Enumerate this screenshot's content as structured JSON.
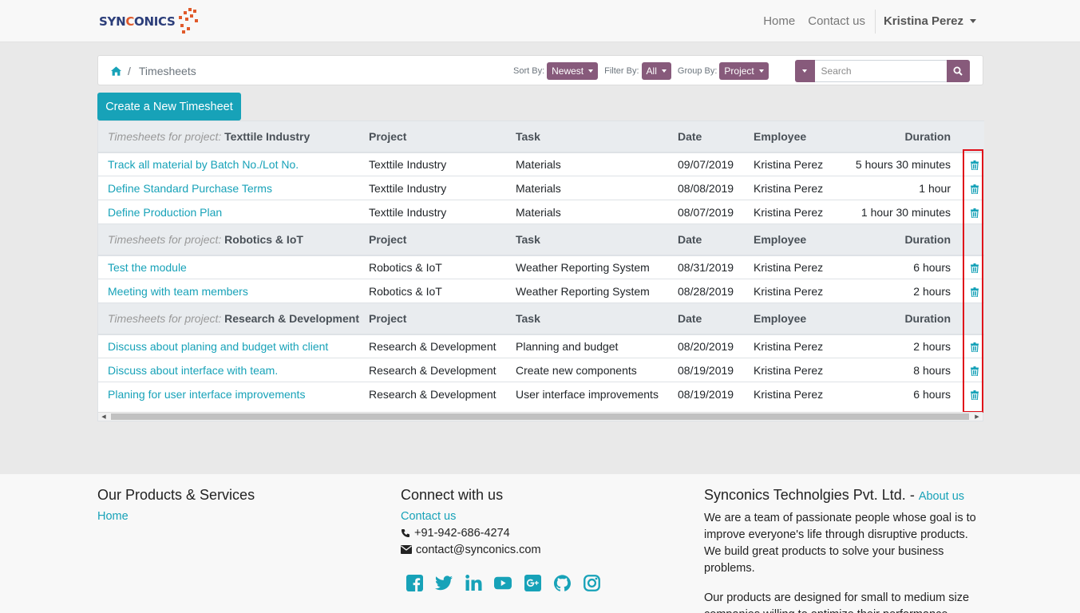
{
  "brand": {
    "name_part1": "SYN",
    "name_part2": "C",
    "name_part3": "ONICS",
    "accent": "#e05a2b",
    "primary": "#2c3e7a"
  },
  "nav": {
    "home": "Home",
    "contact": "Contact us",
    "user": "Kristina Perez"
  },
  "breadcrumb": {
    "current": "Timesheets"
  },
  "filters": {
    "sort_label": "Sort By:",
    "sort_value": "Newest",
    "filter_label": "Filter By:",
    "filter_value": "All",
    "group_label": "Group By:",
    "group_value": "Project"
  },
  "search": {
    "placeholder": "Search"
  },
  "create_button": "Create a New Timesheet",
  "table": {
    "group_prefix": "Timesheets for project:",
    "headers": {
      "project": "Project",
      "task": "Task",
      "date": "Date",
      "employee": "Employee",
      "duration": "Duration"
    },
    "groups": [
      {
        "name": "Texttile Industry",
        "rows": [
          {
            "title": "Track all material by Batch No./Lot No.",
            "project": "Texttile Industry",
            "task": "Materials",
            "date": "09/07/2019",
            "employee": "Kristina Perez",
            "duration": "5 hours 30 minutes"
          },
          {
            "title": "Define Standard Purchase Terms",
            "project": "Texttile Industry",
            "task": "Materials",
            "date": "08/08/2019",
            "employee": "Kristina Perez",
            "duration": "1 hour"
          },
          {
            "title": "Define Production Plan",
            "project": "Texttile Industry",
            "task": "Materials",
            "date": "08/07/2019",
            "employee": "Kristina Perez",
            "duration": "1 hour 30 minutes"
          }
        ]
      },
      {
        "name": "Robotics & IoT",
        "rows": [
          {
            "title": "Test the module",
            "project": "Robotics & IoT",
            "task": "Weather Reporting System",
            "date": "08/31/2019",
            "employee": "Kristina Perez",
            "duration": "6 hours"
          },
          {
            "title": "Meeting with team members",
            "project": "Robotics & IoT",
            "task": "Weather Reporting System",
            "date": "08/28/2019",
            "employee": "Kristina Perez",
            "duration": "2 hours"
          }
        ]
      },
      {
        "name": "Research & Development",
        "rows": [
          {
            "title": "Discuss about planing and budget with client",
            "project": "Research & Development",
            "task": "Planning and budget",
            "date": "08/20/2019",
            "employee": "Kristina Perez",
            "duration": "2 hours"
          },
          {
            "title": "Discuss about interface with team.",
            "project": "Research & Development",
            "task": "Create new components",
            "date": "08/19/2019",
            "employee": "Kristina Perez",
            "duration": "8 hours"
          },
          {
            "title": "Planing for user interface improvements",
            "project": "Research & Development",
            "task": "User interface improvements",
            "date": "08/19/2019",
            "employee": "Kristina Perez",
            "duration": "6 hours"
          }
        ]
      }
    ]
  },
  "footer": {
    "products_title": "Our Products & Services",
    "products_link": "Home",
    "connect_title": "Connect with us",
    "connect_link": "Contact us",
    "phone": "+91-942-686-4274",
    "email": "contact@synconics.com",
    "socials": [
      "facebook-icon",
      "twitter-icon",
      "linkedin-icon",
      "youtube-icon",
      "google-plus-icon",
      "github-icon",
      "instagram-icon"
    ],
    "company_title": "Synconics Technolgies Pvt. Ltd.",
    "company_sep": " - ",
    "about_link": "About us",
    "about_p1": "We are a team of passionate people whose goal is to improve everyone's life through disruptive products. We build great products to solve your business problems.",
    "about_p2": "Our products are designed for small to medium size companies willing to optimize their performance."
  },
  "colors": {
    "teal": "#17a2b8",
    "purple": "#875a7b",
    "highlight": "#e0101a"
  }
}
